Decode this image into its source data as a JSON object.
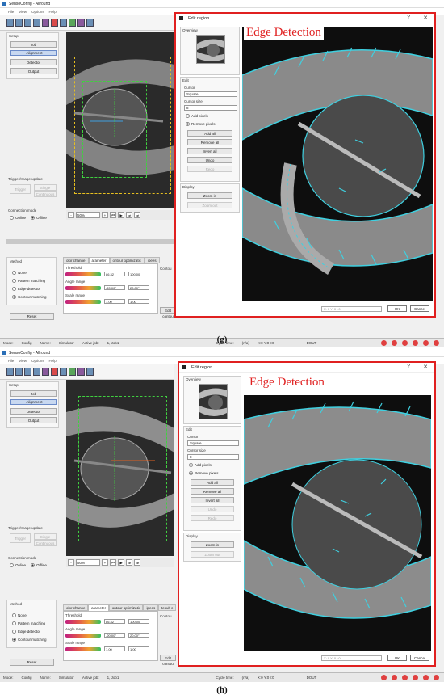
{
  "app": {
    "title": "SensoConfig - Allround",
    "menu": [
      "File",
      "View",
      "Options",
      "Help"
    ],
    "setup_label": "Setup",
    "setup_buttons": [
      "Job",
      "Alignment",
      "Detector",
      "Output"
    ],
    "trigger_label": "Trigger/Image update",
    "trigger_buttons": [
      "Trigger",
      "Single",
      "Continuous"
    ],
    "connection_label": "Connection mode",
    "connection_options": [
      "Online",
      "Offline"
    ],
    "zoom_value": "50%",
    "method_label": "Method",
    "methods": [
      "None",
      "Pattern matching",
      "Edge detector",
      "Contour matching"
    ],
    "reset": "Reset",
    "tabs": [
      "olor channe",
      "arameter",
      "ontour optimizatic",
      "ipees",
      "tesult c"
    ],
    "threshold_label": "Threshold",
    "threshold_values": [
      "86.32",
      "100.00"
    ],
    "angle_label": "Angle range",
    "angle_values": [
      "-20.00°",
      "20.00°"
    ],
    "scale_label": "Scale range",
    "scale_values": [
      "1.00",
      "1.00"
    ],
    "contour_label": "Contou",
    "edit_contour": "Edit contou",
    "status": {
      "mode": "Mode:",
      "mode_val": "Config",
      "name": "Name:",
      "name_val": "Simulator",
      "job": "Active job:",
      "job_val": "1, Job1",
      "cycle": "Cycle time:",
      "cycle_val": "(n/a)",
      "xy": "X:0 Y:0 I:0",
      "dout": "DOUT"
    }
  },
  "dialog": {
    "title": "Edit region",
    "help": "?",
    "close": "✕",
    "overview": "Overview",
    "edit": "Edit",
    "cursor": "Cursor",
    "cursor_value": "Square",
    "cursor_size": "Cursor size",
    "cursor_size_value": "8",
    "add_pixels": "Add pixels",
    "remove_pixels": "Remove pixels",
    "buttons": [
      "Add all",
      "Remove all",
      "Invert all",
      "Undo",
      "Redo"
    ],
    "display": "Display",
    "zoom_in": "Zoom in",
    "zoom_out": "Zoom out",
    "coord": "X: 0 Y: 0 I:0",
    "ok": "OK",
    "cancel": "Cancel",
    "annotation": "Edge Detection"
  },
  "captions": {
    "g": "(g)",
    "h": "(h)"
  },
  "colors": {
    "highlight": "#e02020",
    "edge": "#3fd0e0",
    "selection": "#c8d8f0"
  }
}
